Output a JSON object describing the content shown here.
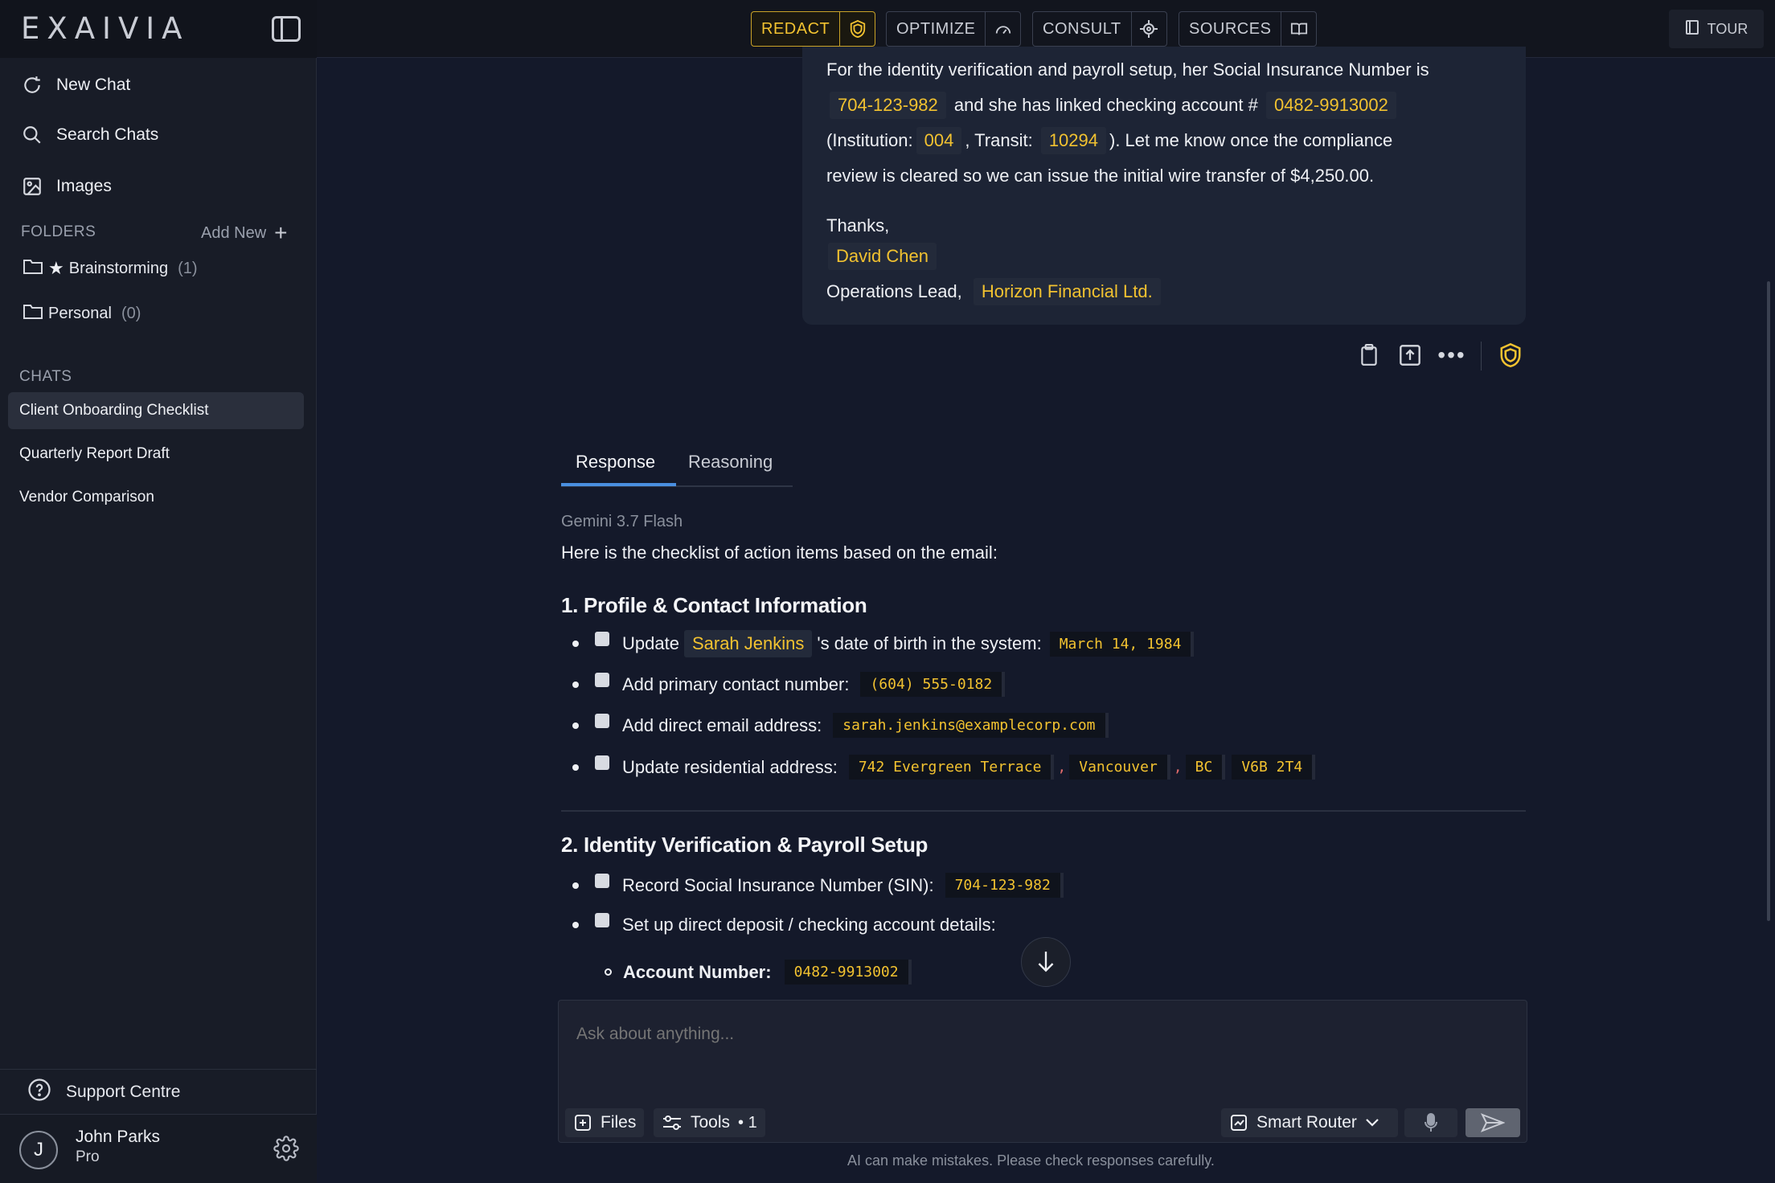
{
  "app": {
    "logo": "EXAIVIA"
  },
  "sidebar": {
    "nav": {
      "new_chat": "New Chat",
      "search_chats": "Search Chats",
      "images": "Images"
    },
    "folders_label": "FOLDERS",
    "add_new": "Add New",
    "folders": [
      {
        "name": "Brainstorming",
        "count": "(1)",
        "starred": true
      },
      {
        "name": "Personal",
        "count": "(0)",
        "starred": false
      }
    ],
    "chats_label": "CHATS",
    "chats": [
      "Client Onboarding Checklist",
      "Quarterly Report Draft",
      "Vendor Comparison"
    ],
    "support": "Support Centre",
    "user": {
      "initial": "J",
      "name": "John Parks",
      "plan": "Pro"
    }
  },
  "toolbar": {
    "redact": "REDACT",
    "optimize": "OPTIMIZE",
    "consult": "CONSULT",
    "sources": "SOURCES",
    "tour": "TOUR"
  },
  "email": {
    "line1": "For the identity verification and payroll setup, her Social Insurance Number is",
    "sin": "704-123-982",
    "line2_mid": "and she has linked checking account #",
    "account": "0482-9913002",
    "inst_label": "(Institution:",
    "institution": "004",
    "transit_label": ", Transit:",
    "transit": "10294",
    "line3_end": "). Let me know once the compliance",
    "line4": "review is cleared so we can issue the initial wire transfer of $4,250.00.",
    "thanks": "Thanks,",
    "sender": "David Chen",
    "role": "Operations Lead,",
    "company": "Horizon Financial Ltd."
  },
  "response": {
    "tabs": [
      "Response",
      "Reasoning"
    ],
    "model": "Gemini 3.7 Flash",
    "intro": "Here is the checklist of action items based on the email:",
    "section1": {
      "heading": "1. Profile & Contact Information",
      "item1_pre": "Update",
      "item1_name": "Sarah Jenkins",
      "item1_post": "'s date of birth in the system:",
      "item1_code": "March 14, 1984",
      "item2": "Add primary contact number:",
      "item2_code": "(604) 555-0182",
      "item3": "Add direct email address:",
      "item3_code": "sarah.jenkins@examplecorp.com",
      "item4": "Update residential address:",
      "address": {
        "street": "742 Evergreen Terrace",
        "sep": ",",
        "city": "Vancouver",
        "province": "BC",
        "postal": "V6B 2T4"
      }
    },
    "section2": {
      "heading": "2. Identity Verification & Payroll Setup",
      "item1": "Record Social Insurance Number (SIN):",
      "item1_code": "704-123-982",
      "item2": "Set up direct deposit / checking account details:",
      "sub1_label": "Account Number:",
      "sub1_code": "0482-9913002"
    }
  },
  "composer": {
    "placeholder": "Ask about anything...",
    "files": "Files",
    "tools": "Tools",
    "tools_count": "• 1",
    "router": "Smart Router"
  },
  "disclaimer": "AI can make mistakes. Please check responses carefully.",
  "colors": {
    "accent_gold": "#f2c230",
    "tab_blue": "#4a8fe0",
    "bg": "#14192a"
  }
}
